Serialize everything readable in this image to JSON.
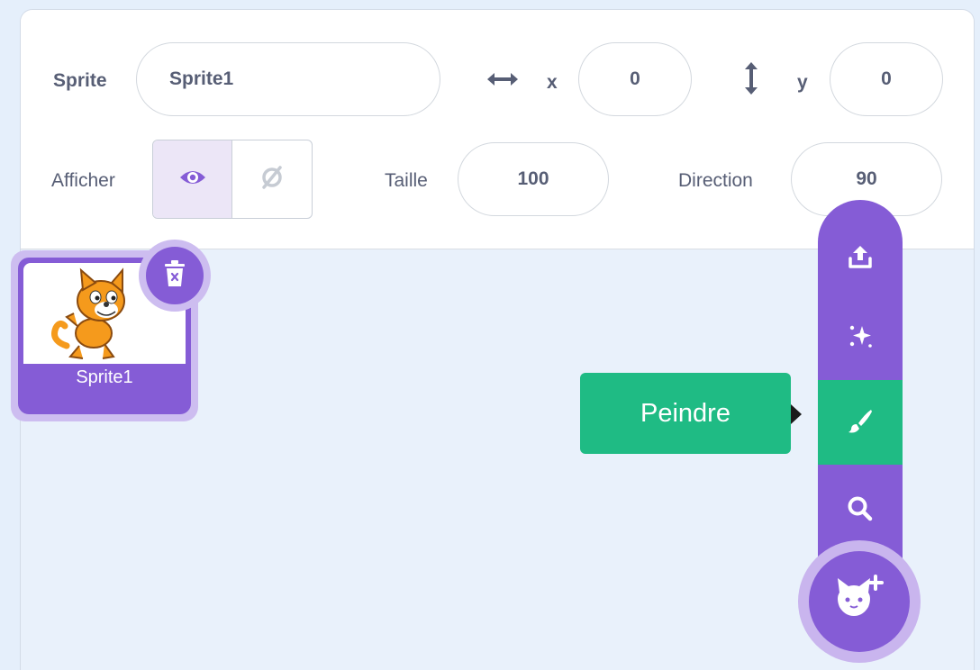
{
  "info": {
    "sprite_label": "Sprite",
    "sprite_name": "Sprite1",
    "x_label": "x",
    "x_value": "0",
    "y_label": "y",
    "y_value": "0",
    "show_label": "Afficher",
    "size_label": "Taille",
    "size_value": "100",
    "direction_label": "Direction",
    "direction_value": "90"
  },
  "sprites": [
    {
      "name": "Sprite1",
      "selected": true
    }
  ],
  "add_menu": {
    "tooltip": "Peindre",
    "items": [
      "upload-icon",
      "surprise-icon",
      "paint-icon",
      "search-icon"
    ],
    "active_item": "paint-icon",
    "fab_icon": "add-sprite-cat-icon"
  },
  "colors": {
    "accent_purple": "#855cd6",
    "active_green": "#1fbb84",
    "text_gray": "#575e75"
  }
}
